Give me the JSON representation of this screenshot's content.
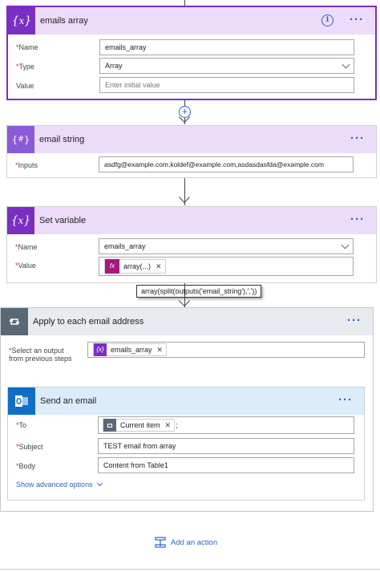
{
  "colors": {
    "variable_purple": "#7a2fc2",
    "variable_header_bg": "#ecdcfa",
    "compose_purple": "#8a5bd8",
    "apply_header_bg": "#e8ebef",
    "apply_icon_bg": "#5a6775",
    "outlook_blue": "#0f6fc6",
    "email_header_bg": "#dcecfa",
    "link_blue": "#2b64c8"
  },
  "card1": {
    "title": "emails array",
    "icon": "curly-braces-x-icon",
    "info_icon": "info-circle-icon",
    "more": "···",
    "name_label": "Name",
    "name_value": "emails_array",
    "type_label": "Type",
    "type_value": "Array",
    "value_label": "Value",
    "value_placeholder": "Enter initial value"
  },
  "card2": {
    "title": "email string",
    "icon": "curly-braces-hash-icon",
    "more": "···",
    "inputs_label": "Inputs",
    "inputs_value": "asdfg@example.com,koldef@example.com,asdasdasfda@example.com"
  },
  "card3": {
    "title": "Set variable",
    "icon": "curly-braces-x-icon",
    "more": "···",
    "name_label": "Name",
    "name_value": "emails_array",
    "value_label": "Value",
    "value_token": "array(...)",
    "value_token_icon": "fx",
    "tooltip": "array(split(outputs('email_string'),','))"
  },
  "card4": {
    "title": "Apply to each email address",
    "icon": "loop-icon",
    "more": "···",
    "select_label_line1": "Select an output",
    "select_label_line2": "from previous steps",
    "select_token": "emails_array",
    "select_token_icon": "{x}"
  },
  "card5": {
    "title": "Send an email",
    "icon": "outlook-icon",
    "more": "···",
    "to_label": "To",
    "to_token": "Current item",
    "to_suffix": ";",
    "subject_label": "Subject",
    "subject_value": "TEST email from array",
    "body_label": "Body",
    "body_value": "Content from Table1",
    "advanced_label": "Show advanced options"
  },
  "add_action": {
    "label": "Add an action"
  },
  "required_mark": "*"
}
